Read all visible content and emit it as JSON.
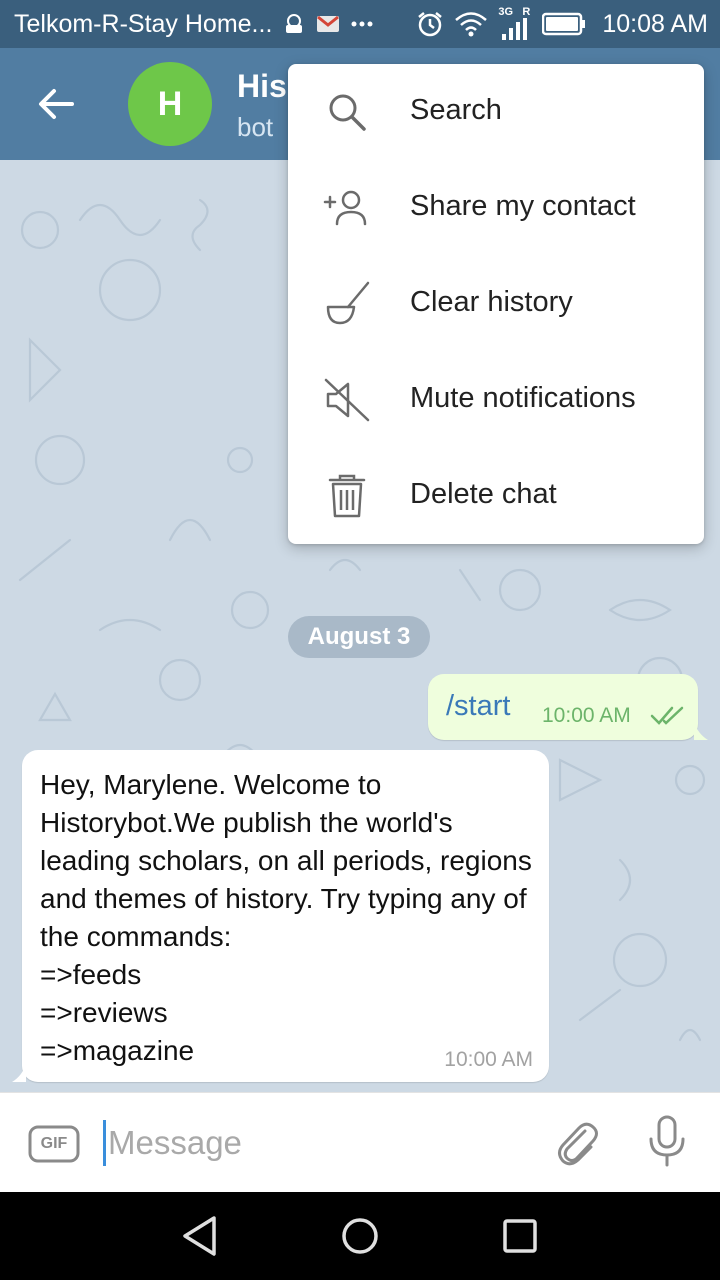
{
  "status_bar": {
    "carrier": "Telkom-R-Stay Home...",
    "network": "3G",
    "roaming": "R",
    "time": "10:08 AM",
    "icons": [
      "app-notification-icon",
      "gmail-icon",
      "more-notifications-icon",
      "alarm-icon",
      "wifi-icon",
      "signal-icon",
      "battery-icon"
    ]
  },
  "header": {
    "avatar_letter": "H",
    "avatar_color": "#6ec749",
    "title": "His",
    "subtitle": "bot",
    "background": "#517da2"
  },
  "menu": {
    "items": [
      {
        "label": "Search",
        "icon": "search-icon"
      },
      {
        "label": "Share my contact",
        "icon": "add-contact-icon"
      },
      {
        "label": "Clear history",
        "icon": "broom-icon"
      },
      {
        "label": "Mute notifications",
        "icon": "mute-icon"
      },
      {
        "label": "Delete chat",
        "icon": "trash-icon"
      }
    ]
  },
  "chat": {
    "date_separator": "August 3",
    "outgoing": {
      "text": "/start",
      "time": "10:00 AM",
      "status": "read"
    },
    "incoming": {
      "text": "Hey, Marylene. Welcome to Historybot.We publish the world's leading scholars, on all periods, regions and themes of history. Try typing any of the commands:\n=>feeds\n=>reviews\n=>magazine",
      "time": "10:00 AM"
    }
  },
  "input_bar": {
    "gif_label": "GIF",
    "placeholder": "Message"
  },
  "colors": {
    "status_bar": "#3a5f7d",
    "chat_background": "#cdd9e4",
    "outgoing_bubble": "#effedd",
    "outgoing_text": "#3a79b8",
    "outgoing_time": "#6cb46a"
  }
}
